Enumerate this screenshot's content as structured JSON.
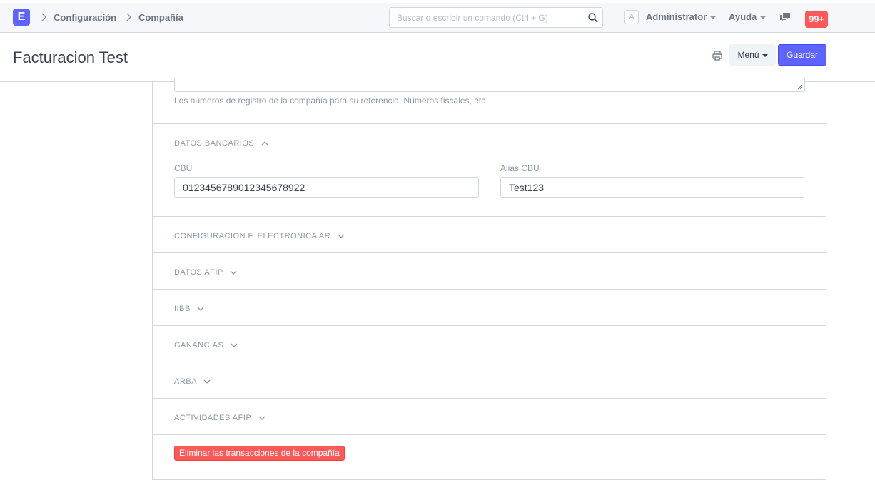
{
  "navbar": {
    "logo_letter": "E",
    "breadcrumbs": [
      "Configuración",
      "Compañía"
    ],
    "search_placeholder": "Buscar o escribir un comando (Ctrl + G)",
    "avatar_letter": "A",
    "user_label": "Administrator",
    "help_label": "Ayuda",
    "notification_count": "99+"
  },
  "page": {
    "title": "Facturacion Test",
    "menu_label": "Menú",
    "save_label": "Guardar"
  },
  "form": {
    "registration_help": "Los números de registro de la compañía para su referencia. Números fiscales, etc",
    "bank_section": {
      "title": "DATOS BANCARIOS",
      "cbu_label": "CBU",
      "cbu_value": "0123456789012345678922",
      "alias_label": "Alias CBU",
      "alias_value": "Test123"
    },
    "collapsed_sections": [
      "CONFIGURACION F. ELECTRONICA AR",
      "DATOS AFIP",
      "IIBB",
      "GANANCIAS",
      "ARBA",
      "ACTIVIDADES AFIP"
    ],
    "delete_transactions_label": "Eliminar las transacciones de la compañía"
  },
  "colors": {
    "primary": "#5e64ff",
    "danger": "#ff5858",
    "border": "#d1d8dd",
    "muted_text": "#8d99a6",
    "text": "#36414c"
  }
}
